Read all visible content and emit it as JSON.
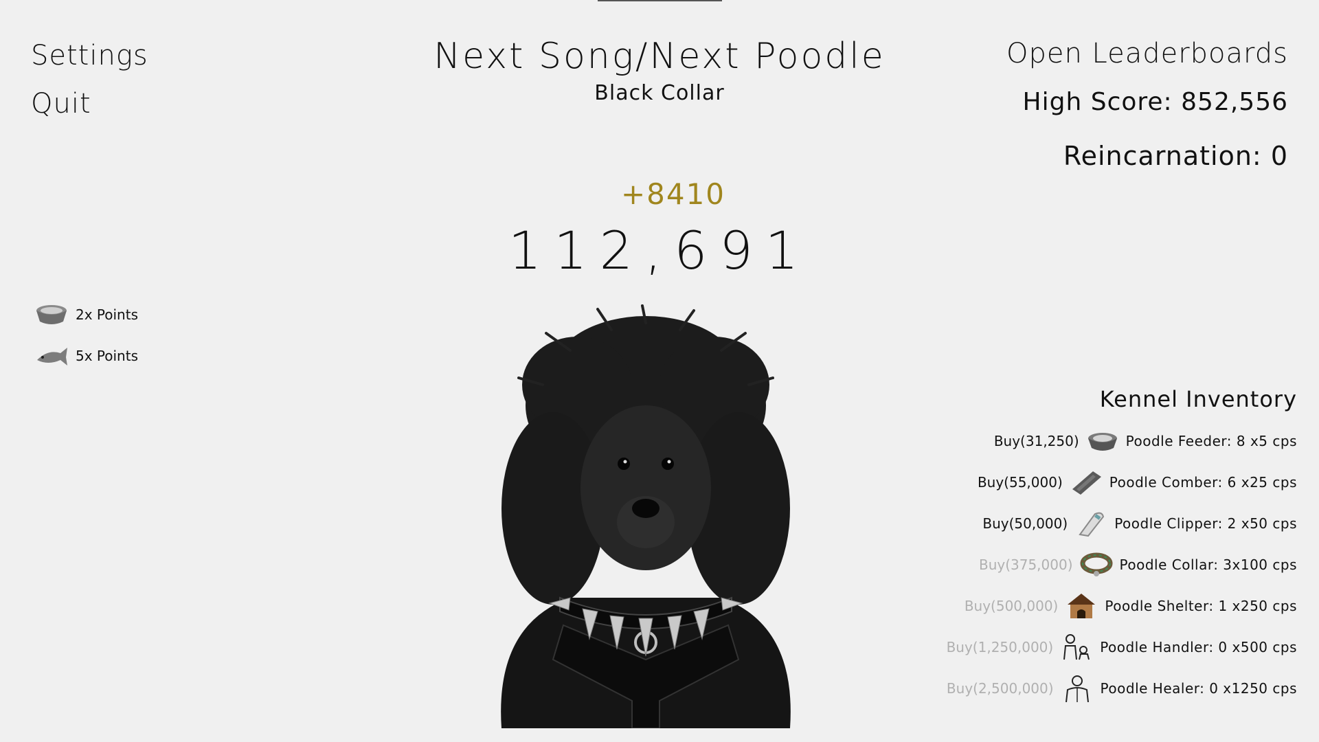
{
  "menu": {
    "settings": "Settings",
    "quit": "Quit"
  },
  "powerups": [
    {
      "label": "2x Points",
      "icon": "bowl-icon"
    },
    {
      "label": "5x Points",
      "icon": "fish-icon"
    }
  ],
  "header": {
    "title": "Next Song/Next Poodle",
    "song": "Black Collar"
  },
  "score": {
    "gain": "+8410",
    "value": "112,691"
  },
  "stats": {
    "leaderboards": "Open Leaderboards",
    "high_score": "High Score: 852,556",
    "reincarnation": "Reincarnation: 0"
  },
  "kennel": {
    "title": "Kennel Inventory",
    "items": [
      {
        "buy": "Buy(31,250)",
        "desc": "Poodle Feeder: 8 x5 cps",
        "icon": "feeder-bowl-icon",
        "affordable": true
      },
      {
        "buy": "Buy(55,000)",
        "desc": "Poodle Comber: 6 x25 cps",
        "icon": "comb-icon",
        "affordable": true
      },
      {
        "buy": "Buy(50,000)",
        "desc": "Poodle Clipper: 2 x50 cps",
        "icon": "clipper-icon",
        "affordable": true
      },
      {
        "buy": "Buy(375,000)",
        "desc": "Poodle Collar: 3x100 cps",
        "icon": "collar-icon",
        "affordable": false
      },
      {
        "buy": "Buy(500,000)",
        "desc": "Poodle Shelter: 1 x250 cps",
        "icon": "doghouse-icon",
        "affordable": false
      },
      {
        "buy": "Buy(1,250,000)",
        "desc": "Poodle Handler: 0 x500 cps",
        "icon": "handler-icon",
        "affordable": false
      },
      {
        "buy": "Buy(2,500,000)",
        "desc": "Poodle Healer: 0 x1250 cps",
        "icon": "healer-icon",
        "affordable": false
      }
    ]
  },
  "colors": {
    "background": "#f0f0f0",
    "gain": "#a0861e",
    "locked": "#b0b0b0"
  }
}
